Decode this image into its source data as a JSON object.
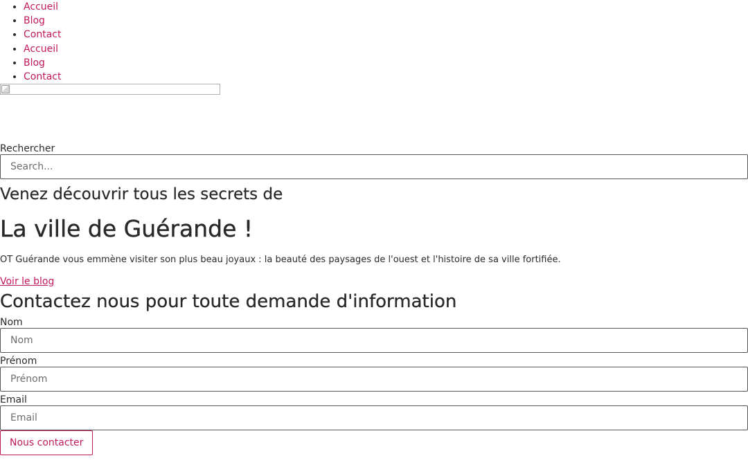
{
  "nav": {
    "items": [
      {
        "label": "Accueil"
      },
      {
        "label": "Blog"
      },
      {
        "label": "Contact"
      },
      {
        "label": "Accueil"
      },
      {
        "label": "Blog"
      },
      {
        "label": "Contact"
      }
    ]
  },
  "search": {
    "label": "Rechercher",
    "placeholder": "Search..."
  },
  "hero": {
    "subtitle": "Venez découvrir tous les secrets de",
    "title": "La ville de Guérande !",
    "description": "OT Guérande vous emmène visiter son plus beau joyaux : la beauté des paysages de l'ouest et l'histoire de sa ville fortifiée.",
    "blog_link": "Voir le blog"
  },
  "contact": {
    "heading": "Contactez nous pour toute demande d'information",
    "fields": {
      "nom": {
        "label": "Nom",
        "placeholder": "Nom"
      },
      "prenom": {
        "label": "Prénom",
        "placeholder": "Prénom"
      },
      "email": {
        "label": "Email",
        "placeholder": "Email"
      }
    },
    "submit_label": "Nous contacter"
  },
  "colors": {
    "accent": "#c2185b",
    "text": "#2a2a2a"
  }
}
